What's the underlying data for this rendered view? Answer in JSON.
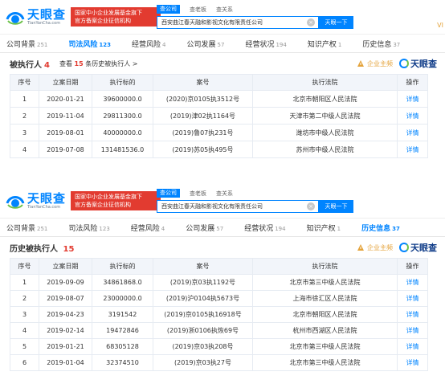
{
  "panels": [
    {
      "brand_cn": "天眼查",
      "brand_en": "TianYanCha.com",
      "slogan": [
        "国家中小企业发展基金旗下",
        "官方备案企业征信机构"
      ],
      "search_tabs": [
        "查公司",
        "查老板",
        "查关系"
      ],
      "search_value": "西安曲江春天融和影视文化有限责任公司",
      "search_button": "天眼一下",
      "vip": "VI",
      "tabs": [
        {
          "label": "公司背景",
          "count": "251"
        },
        {
          "label": "司法风险",
          "count": "123"
        },
        {
          "label": "经营风险",
          "count": "4"
        },
        {
          "label": "公司发展",
          "count": "57"
        },
        {
          "label": "经营状况",
          "count": "194"
        },
        {
          "label": "知识产权",
          "count": "1"
        },
        {
          "label": "历史信息",
          "count": "37"
        }
      ],
      "active_tab": 1,
      "section_title": "被执行人",
      "section_count": "4",
      "section_sub_prefix": "查看",
      "section_sub_count": "15",
      "section_sub_suffix": "条历史被执行人 >",
      "warn_label": "企业主频",
      "brand_small": "天眼查",
      "columns": [
        "序号",
        "立案日期",
        "执行标的",
        "案号",
        "执行法院",
        "操作"
      ],
      "rows": [
        [
          "1",
          "2020-01-21",
          "39600000.0",
          "(2020)京0105执3512号",
          "北京市朝阳区人民法院",
          "详情"
        ],
        [
          "2",
          "2019-11-04",
          "29811300.0",
          "(2019)津02执1164号",
          "天津市第二中级人民法院",
          "详情"
        ],
        [
          "3",
          "2019-08-01",
          "40000000.0",
          "(2019)鲁07执231号",
          "潍坊市中级人民法院",
          "详情"
        ],
        [
          "4",
          "2019-07-08",
          "131481536.0",
          "(2019)苏05执495号",
          "苏州市中级人民法院",
          "详情"
        ]
      ]
    },
    {
      "brand_cn": "天眼查",
      "brand_en": "TianYanCha.com",
      "slogan": [
        "国家中小企业发展基金旗下",
        "官方备案企业征信机构"
      ],
      "search_tabs": [
        "查公司",
        "查老板",
        "查关系"
      ],
      "search_value": "西安曲江春天融和影视文化有限责任公司",
      "search_button": "天眼一下",
      "tabs": [
        {
          "label": "公司背景",
          "count": "251"
        },
        {
          "label": "司法风险",
          "count": "123"
        },
        {
          "label": "经营风险",
          "count": "4"
        },
        {
          "label": "公司发展",
          "count": "57"
        },
        {
          "label": "经营状况",
          "count": "194"
        },
        {
          "label": "知识产权",
          "count": "1"
        },
        {
          "label": "历史信息",
          "count": "37"
        }
      ],
      "active_tab": 6,
      "section_title": "历史被执行人",
      "section_count": "15",
      "warn_label": "企业主频",
      "brand_small": "天眼查",
      "columns": [
        "序号",
        "立案日期",
        "执行标的",
        "案号",
        "执行法院",
        "操作"
      ],
      "rows": [
        [
          "1",
          "2019-09-09",
          "34861868.0",
          "(2019)京03执1192号",
          "北京市第三中级人民法院",
          "详情"
        ],
        [
          "2",
          "2019-08-07",
          "23000000.0",
          "(2019)沪0104执5673号",
          "上海市徐汇区人民法院",
          "详情"
        ],
        [
          "3",
          "2019-04-23",
          "3191542",
          "(2019)京0105执16918号",
          "北京市朝阳区人民法院",
          "详情"
        ],
        [
          "4",
          "2019-02-14",
          "19472846",
          "(2019)浙0106执恢69号",
          "杭州市西湖区人民法院",
          "详情"
        ],
        [
          "5",
          "2019-01-21",
          "68305128",
          "(2019)京03执208号",
          "北京市第三中级人民法院",
          "详情"
        ],
        [
          "6",
          "2019-01-04",
          "32374510",
          "(2019)京03执27号",
          "北京市第三中级人民法院",
          "详情"
        ]
      ]
    }
  ],
  "colors": {
    "accent": "#0084ff",
    "red": "#e23b30",
    "gold": "#e4a33b"
  }
}
